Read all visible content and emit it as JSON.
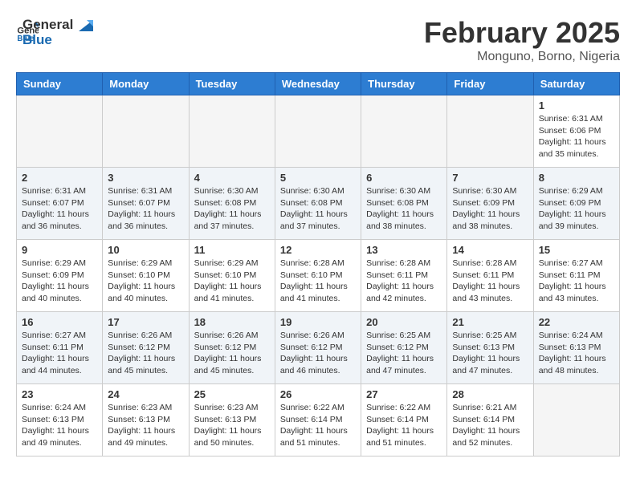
{
  "header": {
    "logo_general": "General",
    "logo_blue": "Blue",
    "month_title": "February 2025",
    "location": "Monguno, Borno, Nigeria"
  },
  "days_of_week": [
    "Sunday",
    "Monday",
    "Tuesday",
    "Wednesday",
    "Thursday",
    "Friday",
    "Saturday"
  ],
  "weeks": [
    {
      "alt": false,
      "days": [
        {
          "date": "",
          "info": ""
        },
        {
          "date": "",
          "info": ""
        },
        {
          "date": "",
          "info": ""
        },
        {
          "date": "",
          "info": ""
        },
        {
          "date": "",
          "info": ""
        },
        {
          "date": "",
          "info": ""
        },
        {
          "date": "1",
          "info": "Sunrise: 6:31 AM\nSunset: 6:06 PM\nDaylight: 11 hours\nand 35 minutes."
        }
      ]
    },
    {
      "alt": true,
      "days": [
        {
          "date": "2",
          "info": "Sunrise: 6:31 AM\nSunset: 6:07 PM\nDaylight: 11 hours\nand 36 minutes."
        },
        {
          "date": "3",
          "info": "Sunrise: 6:31 AM\nSunset: 6:07 PM\nDaylight: 11 hours\nand 36 minutes."
        },
        {
          "date": "4",
          "info": "Sunrise: 6:30 AM\nSunset: 6:08 PM\nDaylight: 11 hours\nand 37 minutes."
        },
        {
          "date": "5",
          "info": "Sunrise: 6:30 AM\nSunset: 6:08 PM\nDaylight: 11 hours\nand 37 minutes."
        },
        {
          "date": "6",
          "info": "Sunrise: 6:30 AM\nSunset: 6:08 PM\nDaylight: 11 hours\nand 38 minutes."
        },
        {
          "date": "7",
          "info": "Sunrise: 6:30 AM\nSunset: 6:09 PM\nDaylight: 11 hours\nand 38 minutes."
        },
        {
          "date": "8",
          "info": "Sunrise: 6:29 AM\nSunset: 6:09 PM\nDaylight: 11 hours\nand 39 minutes."
        }
      ]
    },
    {
      "alt": false,
      "days": [
        {
          "date": "9",
          "info": "Sunrise: 6:29 AM\nSunset: 6:09 PM\nDaylight: 11 hours\nand 40 minutes."
        },
        {
          "date": "10",
          "info": "Sunrise: 6:29 AM\nSunset: 6:10 PM\nDaylight: 11 hours\nand 40 minutes."
        },
        {
          "date": "11",
          "info": "Sunrise: 6:29 AM\nSunset: 6:10 PM\nDaylight: 11 hours\nand 41 minutes."
        },
        {
          "date": "12",
          "info": "Sunrise: 6:28 AM\nSunset: 6:10 PM\nDaylight: 11 hours\nand 41 minutes."
        },
        {
          "date": "13",
          "info": "Sunrise: 6:28 AM\nSunset: 6:11 PM\nDaylight: 11 hours\nand 42 minutes."
        },
        {
          "date": "14",
          "info": "Sunrise: 6:28 AM\nSunset: 6:11 PM\nDaylight: 11 hours\nand 43 minutes."
        },
        {
          "date": "15",
          "info": "Sunrise: 6:27 AM\nSunset: 6:11 PM\nDaylight: 11 hours\nand 43 minutes."
        }
      ]
    },
    {
      "alt": true,
      "days": [
        {
          "date": "16",
          "info": "Sunrise: 6:27 AM\nSunset: 6:11 PM\nDaylight: 11 hours\nand 44 minutes."
        },
        {
          "date": "17",
          "info": "Sunrise: 6:26 AM\nSunset: 6:12 PM\nDaylight: 11 hours\nand 45 minutes."
        },
        {
          "date": "18",
          "info": "Sunrise: 6:26 AM\nSunset: 6:12 PM\nDaylight: 11 hours\nand 45 minutes."
        },
        {
          "date": "19",
          "info": "Sunrise: 6:26 AM\nSunset: 6:12 PM\nDaylight: 11 hours\nand 46 minutes."
        },
        {
          "date": "20",
          "info": "Sunrise: 6:25 AM\nSunset: 6:12 PM\nDaylight: 11 hours\nand 47 minutes."
        },
        {
          "date": "21",
          "info": "Sunrise: 6:25 AM\nSunset: 6:13 PM\nDaylight: 11 hours\nand 47 minutes."
        },
        {
          "date": "22",
          "info": "Sunrise: 6:24 AM\nSunset: 6:13 PM\nDaylight: 11 hours\nand 48 minutes."
        }
      ]
    },
    {
      "alt": false,
      "days": [
        {
          "date": "23",
          "info": "Sunrise: 6:24 AM\nSunset: 6:13 PM\nDaylight: 11 hours\nand 49 minutes."
        },
        {
          "date": "24",
          "info": "Sunrise: 6:23 AM\nSunset: 6:13 PM\nDaylight: 11 hours\nand 49 minutes."
        },
        {
          "date": "25",
          "info": "Sunrise: 6:23 AM\nSunset: 6:13 PM\nDaylight: 11 hours\nand 50 minutes."
        },
        {
          "date": "26",
          "info": "Sunrise: 6:22 AM\nSunset: 6:14 PM\nDaylight: 11 hours\nand 51 minutes."
        },
        {
          "date": "27",
          "info": "Sunrise: 6:22 AM\nSunset: 6:14 PM\nDaylight: 11 hours\nand 51 minutes."
        },
        {
          "date": "28",
          "info": "Sunrise: 6:21 AM\nSunset: 6:14 PM\nDaylight: 11 hours\nand 52 minutes."
        },
        {
          "date": "",
          "info": ""
        }
      ]
    }
  ]
}
